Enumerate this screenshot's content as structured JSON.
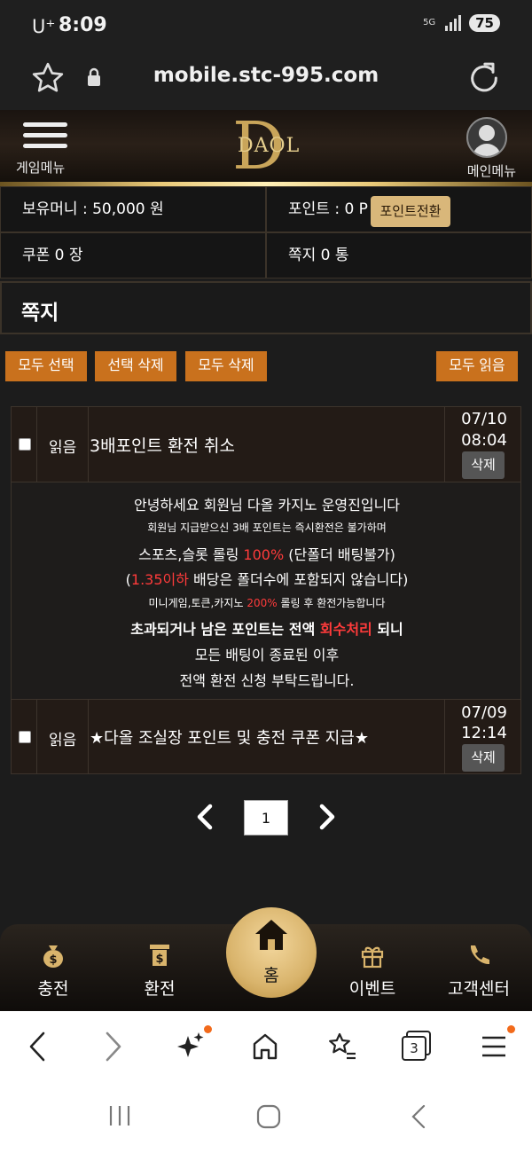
{
  "status_bar": {
    "carrier": "U⁺",
    "time": "8:09",
    "network": "5G",
    "battery": "75"
  },
  "browser": {
    "url": "mobile.stc-995.com",
    "tab_count": "3"
  },
  "header": {
    "left_menu_label": "게임메뉴",
    "right_menu_label": "메인메뉴",
    "logo_text": "DAOL",
    "logo_letter": "D"
  },
  "account": {
    "money": "보유머니 : 50,000 원",
    "points": "포인트 : 0 P",
    "convert_button": "포인트전환",
    "coupons": "쿠폰 0 장",
    "notes": "쪽지 0 통"
  },
  "page_title": "쪽지",
  "actions": {
    "select_all": "모두 선택",
    "delete_selected": "선택 삭제",
    "delete_all": "모두 삭제",
    "read_all": "모두 읽음"
  },
  "messages": [
    {
      "status": "읽음",
      "subject": "3배포인트 환전 취소",
      "date": "07/10",
      "time": "08:04",
      "delete_label": "삭제"
    },
    {
      "status": "읽음",
      "subject": "★다올 조실장 포인트 및 충전 쿠폰 지급★",
      "date": "07/09",
      "time": "12:14",
      "delete_label": "삭제"
    }
  ],
  "message_body": {
    "line1": "안녕하세요 회원님 다올 카지노 운영진입니다",
    "line2": "회원님 지급받으신 3배 포인트는 즉시환전은 불가하며",
    "line3_a": "스포츠,슬롯 롤링 ",
    "line3_red": "100%",
    "line3_b": " (단폴더 배팅불가)",
    "line4_a": "(",
    "line4_red": "1.35이하",
    "line4_b": " 배당은 폴더수에 포함되지 않습니다)",
    "line5_a": "미니게임,토큰,카지노 ",
    "line5_red": "200%",
    "line5_b": " 롤링 후 환전가능합니다",
    "line6_a": "초과되거나 남은 포인트는 전액 ",
    "line6_red": "회수처리",
    "line6_b": " 되니",
    "line7": "모든 배팅이 종료된 이후",
    "line8": "전액 환전 신청 부탁드립니다."
  },
  "pagination": {
    "current_page": "1"
  },
  "bottom_nav": {
    "deposit": "충전",
    "withdraw": "환전",
    "home": "홈",
    "event": "이벤트",
    "support": "고객센터"
  },
  "colors": {
    "accent_gold": "#d9b77a",
    "action_orange": "#c9711d",
    "highlight_red": "#ff3b3b",
    "notification_dot": "#f26a1b"
  }
}
